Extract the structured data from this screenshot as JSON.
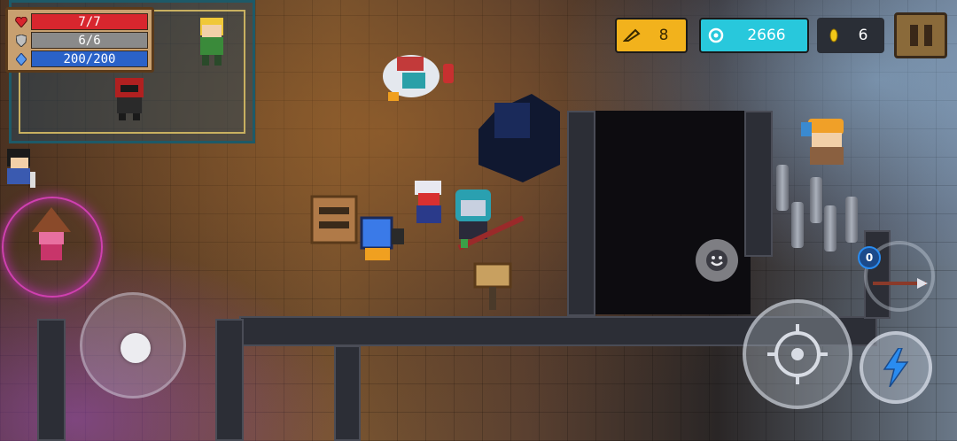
{
  "hud": {
    "hp": "7/7",
    "armor": "6/6",
    "energy": "200/200",
    "gems": "8",
    "coins": "2666",
    "gold": "6"
  },
  "weapon": {
    "energy_cost": "0"
  },
  "icons": {
    "hp": "heart-icon",
    "armor": "shield-icon",
    "energy": "energy-crystal-icon",
    "gems": "gem-icon",
    "coins": "coin-ring-icon",
    "gold": "gold-coin-icon",
    "pause": "pause-icon",
    "emote": "smiley-icon",
    "attack": "crosshair-icon",
    "skill": "lightning-icon"
  },
  "colors": {
    "hp": "#d8262e",
    "armor": "#8a8a8a",
    "energy": "#2a62c8",
    "gems_pill": "#f2b21c",
    "coins_pill": "#28c8dc"
  }
}
